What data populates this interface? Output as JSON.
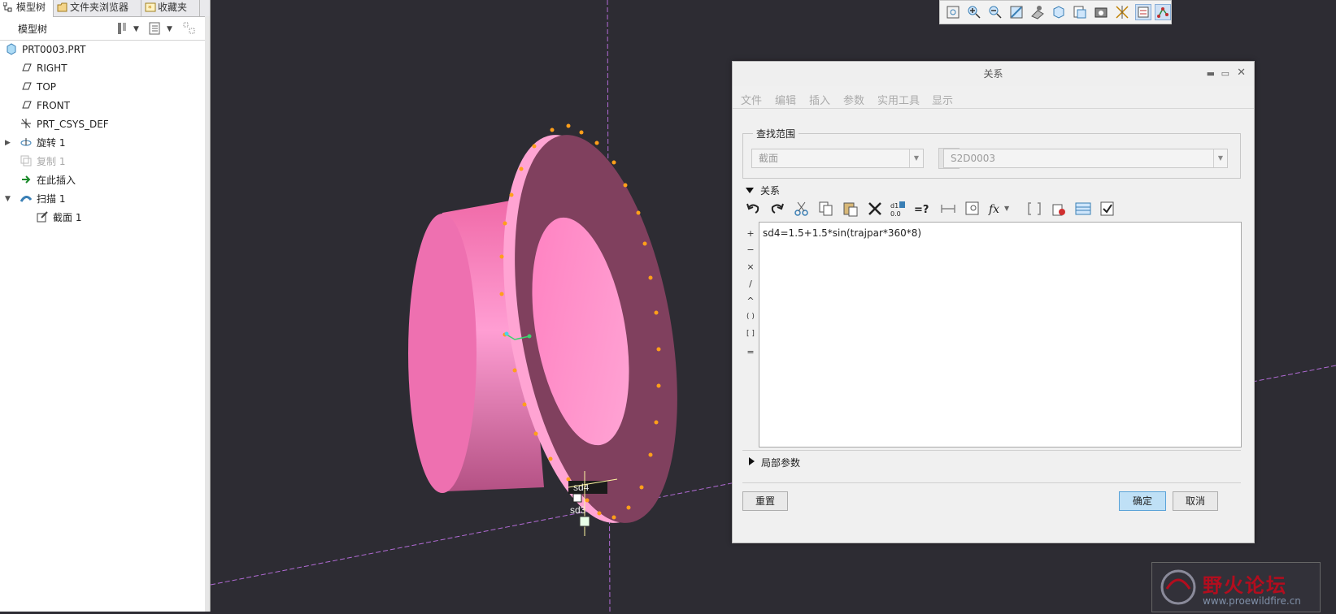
{
  "tabs": [
    {
      "label": "模型树",
      "icon": "model-tree-icon"
    },
    {
      "label": "文件夹浏览器",
      "icon": "folder-browser-icon"
    },
    {
      "label": "收藏夹",
      "icon": "favorites-icon"
    }
  ],
  "tree_toolbar": {
    "title": "模型树"
  },
  "tree": {
    "root": "PRT0003.PRT",
    "items": [
      "RIGHT",
      "TOP",
      "FRONT",
      "PRT_CSYS_DEF",
      "旋转 1",
      "复制 1",
      "在此插入",
      "扫描 1",
      "截面 1"
    ]
  },
  "viewport": {
    "dim_labels": [
      "sd4",
      "sd3"
    ]
  },
  "dialog": {
    "title": "关系",
    "menu": [
      "文件",
      "编辑",
      "插入",
      "参数",
      "实用工具",
      "显示"
    ],
    "lookin": {
      "label": "查找范围",
      "type_value": "截面",
      "object_value": "S2D0003"
    },
    "relations_section": "关系",
    "operators": [
      "+",
      "−",
      "×",
      "/",
      "^",
      "( )",
      "[ ]",
      "="
    ],
    "relation_text": "sd4=1.5+1.5*sin(trajpar*360*8)",
    "local_params_section": "局部参数",
    "buttons": {
      "reset": "重置",
      "ok": "确定",
      "cancel": "取消"
    }
  },
  "watermark": {
    "title": "野火论坛",
    "url": "www.proewildfire.cn"
  },
  "colors": {
    "background": "#2d2c33",
    "part": "#ff7fbe",
    "accent": "#5aa3d8"
  }
}
